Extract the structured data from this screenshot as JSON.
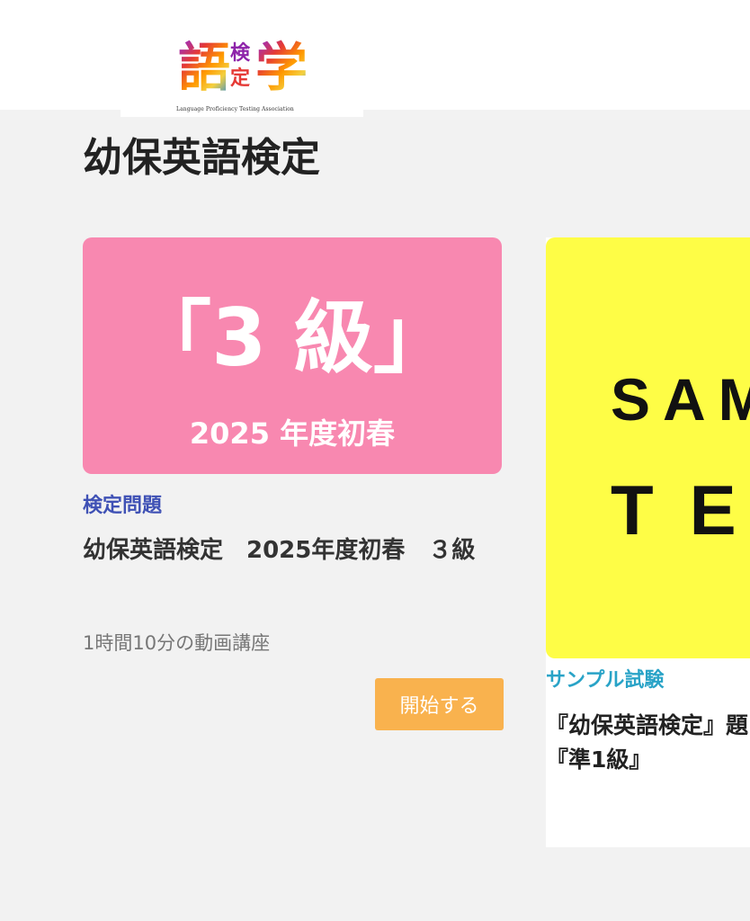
{
  "logo": {
    "big_char_left": "語",
    "small_chars": [
      "検",
      "定"
    ],
    "big_char_right": "学",
    "caption": "Language Proficiency Testing Association"
  },
  "page_title": "幼保英語検定",
  "cards": [
    {
      "thumbnail": {
        "grade": "「3 級」",
        "term": "2025 年度初春"
      },
      "category": "検定問題",
      "title": "幼保英語検定　2025年度初春　３級",
      "description": "1時間10分の動画講座",
      "button_label": "開始する"
    },
    {
      "thumbnail": {
        "line1": "SAM",
        "line2": "TE"
      },
      "category": "サンプル試験",
      "title": "『幼保英語検定』題『準1級』"
    }
  ],
  "colors": {
    "background": "#f2f2f2",
    "card1_thumb": "#f888b0",
    "card2_thumb": "#fefd46",
    "category1": "#3f51b5",
    "category2": "#29a3c7",
    "button": "#f9b24e"
  }
}
